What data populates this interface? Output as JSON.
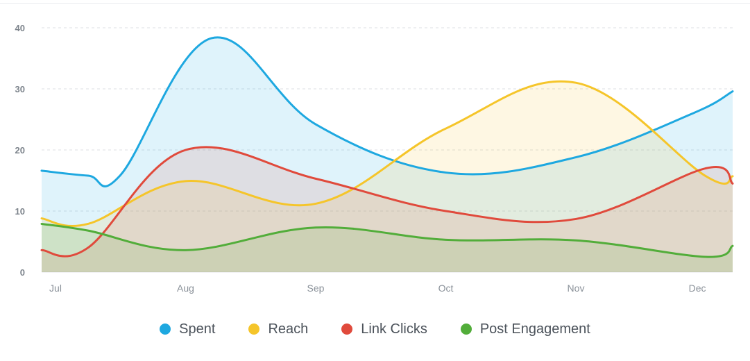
{
  "chart_data": {
    "type": "area",
    "x": [
      "Jul",
      "Aug",
      "Sep",
      "Oct",
      "Nov",
      "Dec"
    ],
    "ylim": [
      0,
      40
    ],
    "yticks": [
      0,
      10,
      20,
      30,
      40
    ],
    "grid": true,
    "legend_position": "bottom",
    "series": [
      {
        "name": "Spent",
        "color": "#1ea8e0",
        "fill": "rgba(30,168,224,0.14)",
        "points": [
          [
            0.0,
            16.6
          ],
          [
            0.25,
            15.8
          ],
          [
            0.5,
            15.9
          ],
          [
            1.2,
            38.3
          ],
          [
            2.0,
            24.2
          ],
          [
            3.0,
            16.3
          ],
          [
            4.0,
            18.8
          ],
          [
            4.9,
            26.0
          ],
          [
            5.15,
            29.6
          ]
        ]
      },
      {
        "name": "Reach",
        "color": "#f5c52a",
        "fill": "rgba(245,197,42,0.13)",
        "points": [
          [
            0.0,
            8.8
          ],
          [
            0.25,
            7.9
          ],
          [
            1.0,
            14.9
          ],
          [
            2.0,
            11.2
          ],
          [
            3.0,
            23.5
          ],
          [
            4.0,
            31.0
          ],
          [
            5.0,
            15.7
          ],
          [
            5.15,
            15.7
          ]
        ]
      },
      {
        "name": "Link Clicks",
        "color": "#e04a3c",
        "fill": "rgba(224,74,60,0.12)",
        "points": [
          [
            0.0,
            3.6
          ],
          [
            0.25,
            4.0
          ],
          [
            1.0,
            20.0
          ],
          [
            2.0,
            15.3
          ],
          [
            3.0,
            10.0
          ],
          [
            4.0,
            8.7
          ],
          [
            5.0,
            17.0
          ],
          [
            5.15,
            14.5
          ]
        ]
      },
      {
        "name": "Post Engagement",
        "color": "#52ad3a",
        "fill": "rgba(82,173,58,0.14)",
        "points": [
          [
            0.0,
            7.9
          ],
          [
            0.25,
            6.8
          ],
          [
            1.0,
            3.6
          ],
          [
            2.0,
            7.3
          ],
          [
            3.0,
            5.3
          ],
          [
            4.0,
            5.2
          ],
          [
            5.0,
            2.5
          ],
          [
            5.15,
            4.3
          ]
        ]
      }
    ]
  }
}
